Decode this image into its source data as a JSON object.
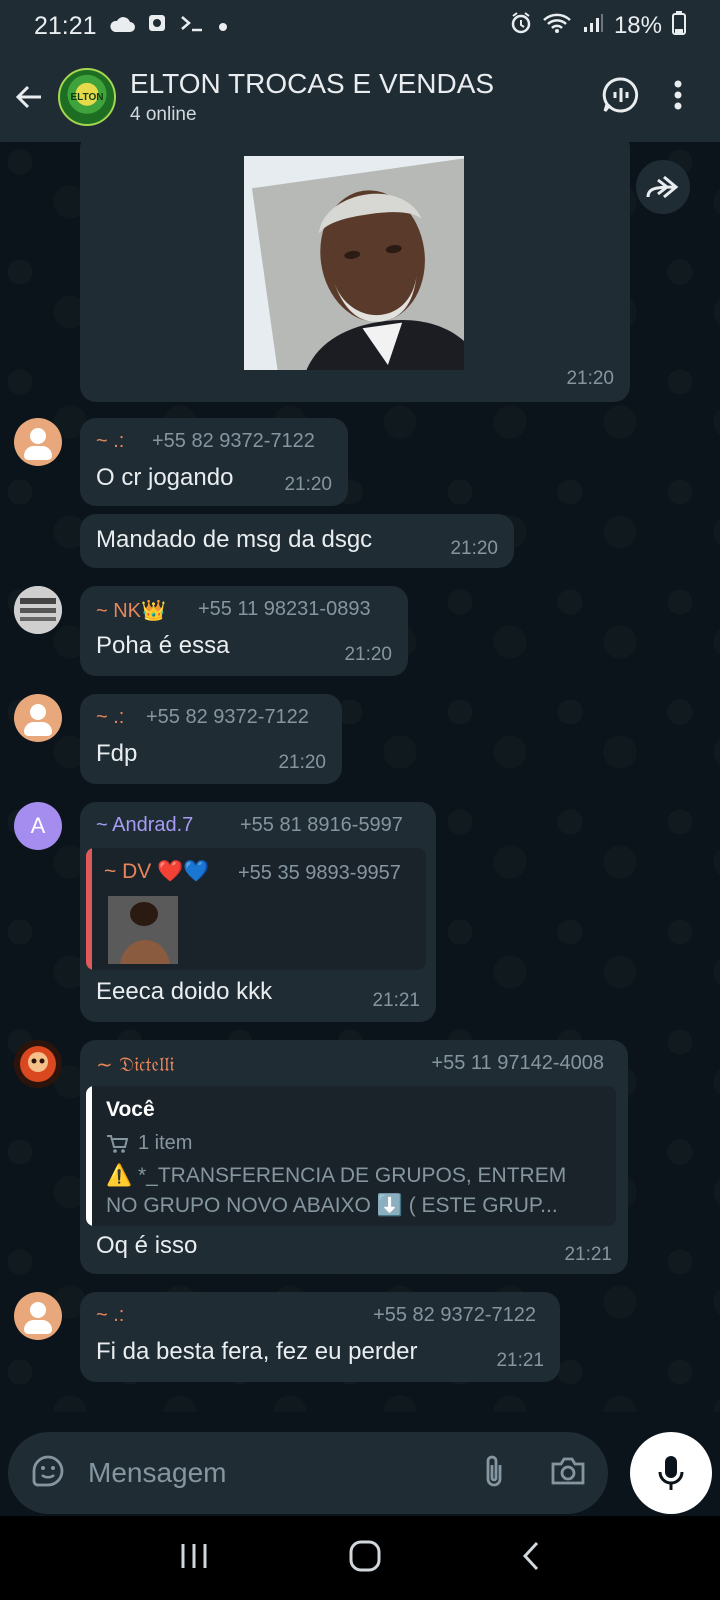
{
  "status": {
    "time": "21:21",
    "battery": "18%",
    "icons": [
      "cloud-icon",
      "screenshot-icon",
      "terminal-icon",
      "dot-icon",
      "alarm-icon",
      "wifi-icon",
      "signal-icon",
      "battery-icon"
    ]
  },
  "header": {
    "title": "ELTON TROCAS E VENDAS",
    "subtitle": "4 online",
    "avatar_text": "ELTON"
  },
  "messages": [
    {
      "id": "m0",
      "type": "image",
      "time": "21:20"
    },
    {
      "id": "m1",
      "sender": "~ .:",
      "phone": "+55 82 9372-7122",
      "text": "O cr jogando",
      "time": "21:20"
    },
    {
      "id": "m2",
      "text": "Mandado de msg da dsgc",
      "time": "21:20"
    },
    {
      "id": "m3",
      "sender": "~ NK👑",
      "phone": "+55 11 98231-0893",
      "text": "Poha é essa",
      "time": "21:20"
    },
    {
      "id": "m4",
      "sender": "~ .:",
      "phone": "+55 82 9372-7122",
      "text": "Fdp",
      "time": "21:20"
    },
    {
      "id": "m5",
      "sender": "~ Andrad.7",
      "avatar_letter": "A",
      "phone": "+55 81 8916-5997",
      "quote": {
        "sender": "~ DV ❤️💙",
        "phone": "+55 35 9893-9957"
      },
      "text": "Eeeca doido kkk",
      "time": "21:21"
    },
    {
      "id": "m6",
      "sender": "~ 𝔇𝔦𝔠𝔱𝔢𝔩𝔩𝔦",
      "phone": "+55 11 97142-4008",
      "quote": {
        "sender": "Você",
        "sub": "1 item",
        "line1": "⚠️ *_TRANSFERENCIA DE GRUPOS, ENTREM",
        "line2": "NO GRUPO NOVO ABAIXO ⬇️ ( ESTE GRUP..."
      },
      "text": "Oq é isso",
      "time": "21:21"
    },
    {
      "id": "m7",
      "sender": "~ .:",
      "phone": "+55 82 9372-7122",
      "text": "Fi da besta fera, fez eu perder",
      "time": "21:21"
    }
  ],
  "composer": {
    "placeholder": "Mensagem"
  },
  "colors": {
    "background": "#0b141a",
    "bubble": "#1f2c34",
    "sender_orange": "#e8865a",
    "sender_purple": "#a69cf5",
    "quote_red": "#e05a5a",
    "quote_white": "#ffffff"
  }
}
